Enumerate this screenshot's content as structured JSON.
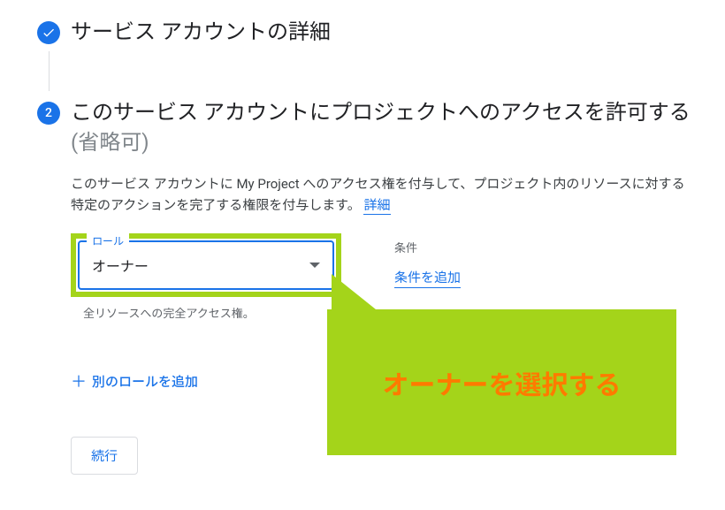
{
  "step1": {
    "title": "サービス アカウントの詳細"
  },
  "step2": {
    "number": "2",
    "title_main": "このサービス アカウントにプロジェクトへのアクセスを許可する ",
    "title_optional": "(省略可)",
    "description": "このサービス アカウントに My Project へのアクセス権を付与して、プロジェクト内のリソースに対する特定のアクションを完了する権限を付与します。 ",
    "learn_more": "詳細",
    "role": {
      "label": "ロール",
      "value": "オーナー",
      "helper": "全リソースへの完全アクセス権。"
    },
    "condition": {
      "label": "条件",
      "add": "条件を追加"
    },
    "add_role": "別のロールを追加",
    "continue": "続行"
  },
  "annotation": {
    "text": "オーナーを選択する"
  }
}
